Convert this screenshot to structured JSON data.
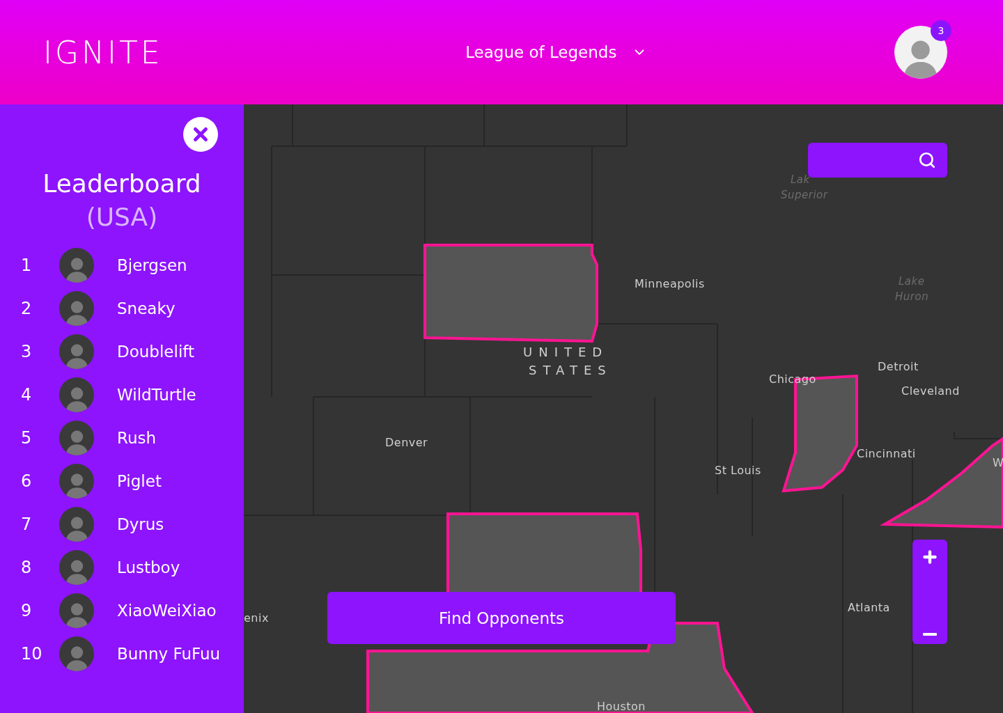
{
  "header": {
    "logo": "IGNITE",
    "game_selector": "League of Legends",
    "notification_count": "3"
  },
  "leaderboard": {
    "title": "Leaderboard",
    "region": "(USA)",
    "players": [
      {
        "rank": "1",
        "name": "Bjergsen"
      },
      {
        "rank": "2",
        "name": "Sneaky"
      },
      {
        "rank": "3",
        "name": "Doublelift"
      },
      {
        "rank": "4",
        "name": "WildTurtle"
      },
      {
        "rank": "5",
        "name": "Rush"
      },
      {
        "rank": "6",
        "name": "Piglet"
      },
      {
        "rank": "7",
        "name": "Dyrus"
      },
      {
        "rank": "8",
        "name": "Lustboy"
      },
      {
        "rank": "9",
        "name": "XiaoWeiXiao"
      },
      {
        "rank": "10",
        "name": "Bunny FuFuu"
      }
    ]
  },
  "map": {
    "labels": [
      {
        "text": "Lak",
        "kind": "water"
      },
      {
        "text": "Superior",
        "kind": "water"
      },
      {
        "text": "Minneapolis",
        "kind": "city"
      },
      {
        "text": "Lake",
        "kind": "water"
      },
      {
        "text": "Huron",
        "kind": "water"
      },
      {
        "text": "UNITED",
        "kind": "country"
      },
      {
        "text": "STATES",
        "kind": "country"
      },
      {
        "text": "Detroit",
        "kind": "city"
      },
      {
        "text": "Chicago",
        "kind": "city"
      },
      {
        "text": "Cleveland",
        "kind": "city"
      },
      {
        "text": "Denver",
        "kind": "city"
      },
      {
        "text": "Cincinnati",
        "kind": "city"
      },
      {
        "text": "St Louis",
        "kind": "city"
      },
      {
        "text": "W",
        "kind": "city"
      },
      {
        "text": "Atlanta",
        "kind": "city"
      },
      {
        "text": "enix",
        "kind": "city"
      },
      {
        "text": "Houston",
        "kind": "city"
      }
    ],
    "find_button": "Find Opponents"
  }
}
